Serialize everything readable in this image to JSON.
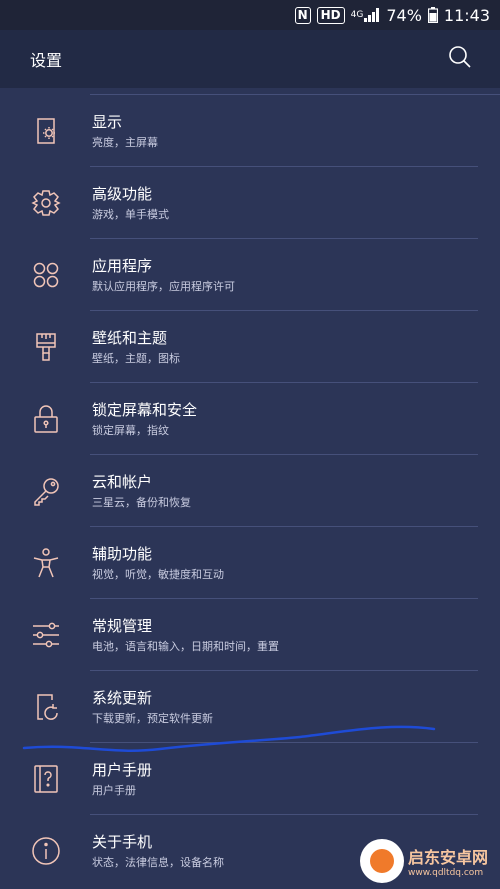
{
  "status_bar": {
    "nfc": "N",
    "hd": "HD",
    "network": "4G",
    "battery": "74%",
    "time": "11:43"
  },
  "header": {
    "title": "设置"
  },
  "items": [
    {
      "icon": "display-icon",
      "title": "显示",
      "subtitle": "亮度，主屏幕"
    },
    {
      "icon": "advanced-features-icon",
      "title": "高级功能",
      "subtitle": "游戏，单手模式"
    },
    {
      "icon": "apps-icon",
      "title": "应用程序",
      "subtitle": "默认应用程序，应用程序许可"
    },
    {
      "icon": "wallpaper-brush-icon",
      "title": "壁纸和主题",
      "subtitle": "壁纸，主题，图标"
    },
    {
      "icon": "lock-icon",
      "title": "锁定屏幕和安全",
      "subtitle": "锁定屏幕，指纹"
    },
    {
      "icon": "key-icon",
      "title": "云和帐户",
      "subtitle": "三星云，备份和恢复"
    },
    {
      "icon": "accessibility-icon",
      "title": "辅助功能",
      "subtitle": "视觉，听觉，敏捷度和互动"
    },
    {
      "icon": "sliders-icon",
      "title": "常规管理",
      "subtitle": "电池，语言和输入，日期和时间，重置"
    },
    {
      "icon": "software-update-icon",
      "title": "系统更新",
      "subtitle": "下载更新，预定软件更新"
    },
    {
      "icon": "user-manual-icon",
      "title": "用户手册",
      "subtitle": "用户手册"
    },
    {
      "icon": "info-icon",
      "title": "关于手机",
      "subtitle": "状态，法律信息，设备名称"
    }
  ],
  "watermark": {
    "name": "启东安卓网",
    "url": "www.qdltdq.com"
  },
  "colors": {
    "background": "#2c3557",
    "header": "#222a45",
    "icon": "#f1c5b8"
  }
}
